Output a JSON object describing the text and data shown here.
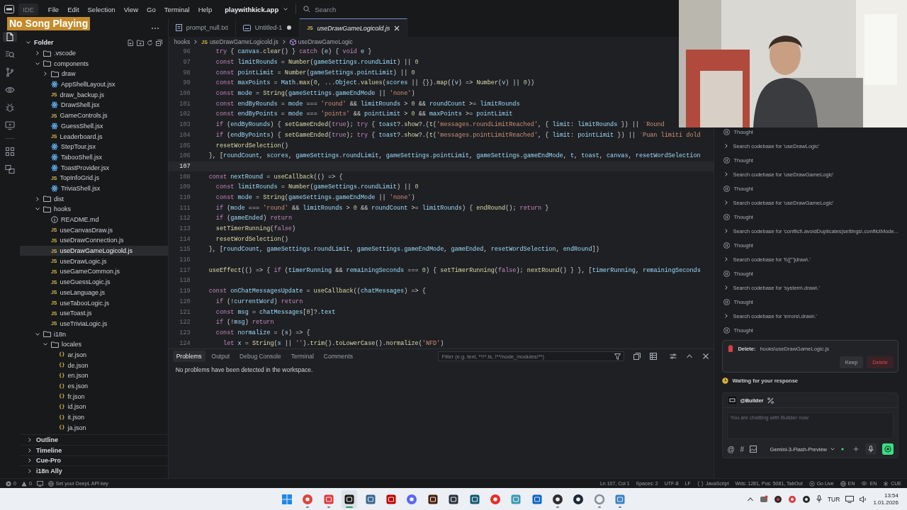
{
  "overlay": {
    "text": "No Song Playing"
  },
  "menubar": {
    "app_label": "IDE",
    "menus": [
      "File",
      "Edit",
      "Selection",
      "View",
      "Go",
      "Terminal",
      "Help"
    ],
    "workspace": "playwithkick.app",
    "search_placeholder": "Search"
  },
  "activity_bar": [
    {
      "kind": "files",
      "selected": true
    },
    {
      "kind": "search",
      "selected": false
    },
    {
      "kind": "branch",
      "selected": false
    },
    {
      "kind": "eye",
      "selected": false
    },
    {
      "kind": "bug",
      "selected": false
    },
    {
      "kind": "monitor",
      "selected": false
    },
    {
      "kind": "grid",
      "selected": false
    },
    {
      "kind": "translate",
      "selected": false
    }
  ],
  "explorer": {
    "root": {
      "label": "Folder",
      "expanded": true,
      "children": [
        {
          "label": ".vscode",
          "kind": "folder",
          "expanded": false,
          "selected": false
        },
        {
          "label": "components",
          "kind": "folder",
          "expanded": true,
          "selected": false,
          "children": [
            {
              "label": "draw",
              "kind": "folder",
              "expanded": false,
              "selected": false
            },
            {
              "label": "AppShellLayout.jsx",
              "kind": "jsx",
              "selected": false
            },
            {
              "label": "draw_backup.js",
              "kind": "js",
              "icon_text": "JS",
              "selected": false
            },
            {
              "label": "DrawShell.jsx",
              "kind": "jsx",
              "selected": false
            },
            {
              "label": "GameControls.js",
              "kind": "js",
              "icon_text": "JS",
              "selected": false
            },
            {
              "label": "GuessShell.jsx",
              "kind": "jsx",
              "selected": false
            },
            {
              "label": "Leaderboard.js",
              "kind": "js",
              "icon_text": "JS",
              "selected": false
            },
            {
              "label": "StepTour.jsx",
              "kind": "jsx",
              "selected": false
            },
            {
              "label": "TabooShell.jsx",
              "kind": "jsx",
              "selected": false
            },
            {
              "label": "ToastProvider.jsx",
              "kind": "jsx",
              "selected": false
            },
            {
              "label": "TopInfoGrid.js",
              "kind": "js",
              "icon_text": "JS",
              "selected": false
            },
            {
              "label": "TriviaShell.jsx",
              "kind": "jsx",
              "selected": false
            }
          ]
        },
        {
          "label": "dist",
          "kind": "folder",
          "expanded": false,
          "selected": false
        },
        {
          "label": "hooks",
          "kind": "folder",
          "expanded": true,
          "selected": false,
          "children": [
            {
              "label": "README.md",
              "kind": "md",
              "selected": false
            },
            {
              "label": "useCanvasDraw.js",
              "kind": "js",
              "icon_text": "JS",
              "selected": false
            },
            {
              "label": "useDrawConnection.js",
              "kind": "js",
              "icon_text": "JS",
              "selected": false
            },
            {
              "label": "useDrawGameLogicold.js",
              "kind": "js",
              "icon_text": "JS",
              "selected": true
            },
            {
              "label": "useDrawLogic.js",
              "kind": "js",
              "icon_text": "JS",
              "selected": false
            },
            {
              "label": "useGameCommon.js",
              "kind": "js",
              "icon_text": "JS",
              "selected": false
            },
            {
              "label": "useGuessLogic.js",
              "kind": "js",
              "icon_text": "JS",
              "selected": false
            },
            {
              "label": "useLanguage.js",
              "kind": "js",
              "icon_text": "JS",
              "selected": false
            },
            {
              "label": "useTabooLogic.js",
              "kind": "js",
              "icon_text": "JS",
              "selected": false
            },
            {
              "label": "useToast.js",
              "kind": "js",
              "icon_text": "JS",
              "selected": false
            },
            {
              "label": "useTriviaLogic.js",
              "kind": "js",
              "icon_text": "JS",
              "selected": false
            }
          ]
        },
        {
          "label": "i18n",
          "kind": "folder",
          "expanded": true,
          "selected": false,
          "children": [
            {
              "label": "locales",
              "kind": "folder",
              "expanded": true,
              "selected": false,
              "children": [
                {
                  "label": "ar.json",
                  "kind": "json",
                  "icon_text": "{}",
                  "selected": false
                },
                {
                  "label": "de.json",
                  "kind": "json",
                  "icon_text": "{}",
                  "selected": false
                },
                {
                  "label": "en.json",
                  "kind": "json",
                  "icon_text": "{}",
                  "selected": false
                },
                {
                  "label": "es.json",
                  "kind": "json",
                  "icon_text": "{}",
                  "selected": false
                },
                {
                  "label": "fr.json",
                  "kind": "json",
                  "icon_text": "{}",
                  "selected": false
                },
                {
                  "label": "id.json",
                  "kind": "json",
                  "icon_text": "{}",
                  "selected": false
                },
                {
                  "label": "it.json",
                  "kind": "json",
                  "icon_text": "{}",
                  "selected": false
                },
                {
                  "label": "ja.json",
                  "kind": "json",
                  "icon_text": "{}",
                  "selected": false
                }
              ]
            }
          ]
        }
      ]
    }
  },
  "sidebar_sections": [
    {
      "label": "Outline",
      "expanded": false
    },
    {
      "label": "Timeline",
      "expanded": false
    },
    {
      "label": "Cue-Pro",
      "expanded": false
    },
    {
      "label": "i18n Ally",
      "expanded": false
    }
  ],
  "editor": {
    "tabs": [
      {
        "label": "prompt_null.txt",
        "kind": "text",
        "selected": false,
        "modified": false
      },
      {
        "label": "Untitled-1",
        "kind": "untitled",
        "selected": false,
        "modified": true
      },
      {
        "label": "useDrawGameLogicold.js",
        "kind": "js",
        "icon_text": "JS",
        "selected": true,
        "modified": false
      }
    ],
    "breadcrumb": [
      {
        "text": "hooks"
      },
      {
        "text": "useDrawGameLogicold.js",
        "icon_text": "JS"
      },
      {
        "text": "useDrawGameLogic",
        "kind": "symbol"
      }
    ],
    "lines": [
      {
        "number": "96",
        "current": false,
        "code": "  try { canvas.clear() } catch (e) { void e }"
      },
      {
        "number": "97",
        "current": false,
        "code": "  const limitRounds = Number(gameSettings.roundLimit) || 0"
      },
      {
        "number": "98",
        "current": false,
        "code": "  const pointLimit = Number(gameSettings.pointLimit) || 0"
      },
      {
        "number": "99",
        "current": false,
        "code": "  const maxPoints = Math.max(0, ...Object.values(scores || {}).map((v) => Number(v) || 0))"
      },
      {
        "number": "100",
        "current": false,
        "code": "  const mode = String(gameSettings.gameEndMode || 'none')"
      },
      {
        "number": "101",
        "current": false,
        "code": "  const endByRounds = mode === 'round' && limitRounds > 0 && roundCount >= limitRounds"
      },
      {
        "number": "102",
        "current": false,
        "code": "  const endByPoints = mode === 'points' && pointLimit > 0 && maxPoints >= pointLimit"
      },
      {
        "number": "103",
        "current": false,
        "code": "  if (endByRounds) { setGameEnded(true); try { toast?.show?.(t('messages.roundLimitReached', { limit: limitRounds }) || `Round"
      },
      {
        "number": "104",
        "current": false,
        "code": "  if (endByPoints) { setGameEnded(true); try { toast?.show?.(t('messages.pointLimitReached', { limit: pointLimit }) || `Puan limiti dold"
      },
      {
        "number": "105",
        "current": false,
        "code": "  resetWordSelection()"
      },
      {
        "number": "106",
        "current": false,
        "code": "}, [roundCount, scores, gameSettings.roundLimit, gameSettings.pointLimit, gameSettings.gameEndMode, t, toast, canvas, resetWordSelection"
      },
      {
        "number": "107",
        "current": true
      },
      {
        "number": "108",
        "current": false,
        "code": "const nextRound = useCallback(() => {"
      },
      {
        "number": "109",
        "current": false,
        "code": "  const limitRounds = Number(gameSettings.roundLimit) || 0"
      },
      {
        "number": "110",
        "current": false,
        "code": "  const mode = String(gameSettings.gameEndMode || 'none')"
      },
      {
        "number": "111",
        "current": false,
        "code": "  if (mode === 'round' && limitRounds > 0 && roundCount >= limitRounds) { endRound(); return }"
      },
      {
        "number": "112",
        "current": false,
        "code": "  if (gameEnded) return"
      },
      {
        "number": "113",
        "current": false,
        "code": "  setTimerRunning(false)"
      },
      {
        "number": "114",
        "current": false,
        "code": "  resetWordSelection()"
      },
      {
        "number": "115",
        "current": false,
        "code": "}, [roundCount, gameSettings.roundLimit, gameSettings.gameEndMode, gameEnded, resetWordSelection, endRound])"
      },
      {
        "number": "116",
        "current": false
      },
      {
        "number": "117",
        "current": false,
        "code": "useEffect(() => { if (timerRunning && remainingSeconds === 0) { setTimerRunning(false); nextRound() } }, [timerRunning, remainingSeconds"
      },
      {
        "number": "118",
        "current": false
      },
      {
        "number": "119",
        "current": false,
        "code": "const onChatMessagesUpdate = useCallback((chatMessages) => {"
      },
      {
        "number": "120",
        "current": false,
        "code": "  if (!currentWord) return"
      },
      {
        "number": "121",
        "current": false,
        "code": "  const msg = chatMessages[0]?.text"
      },
      {
        "number": "122",
        "current": false,
        "code": "  if (!msg) return"
      },
      {
        "number": "123",
        "current": false,
        "code": "  const normalize = (s) => {"
      },
      {
        "number": "124",
        "current": false,
        "code": "    let x = String(s || '').trim().toLowerCase().normalize('NFD')"
      }
    ]
  },
  "panel": {
    "tabs": [
      {
        "label": "Problems",
        "selected": true
      },
      {
        "label": "Output",
        "selected": false
      },
      {
        "label": "Debug Console",
        "selected": false
      },
      {
        "label": "Terminal",
        "selected": false
      },
      {
        "label": "Comments",
        "selected": false
      }
    ],
    "filter_placeholder": "Filter (e.g. text, **/*.ts, !**/node_modules/**)",
    "message": "No problems have been detected in the workspace."
  },
  "chat": {
    "items": [
      {
        "kind": "thought",
        "text": "Thought"
      },
      {
        "kind": "search",
        "text": "Search codebase for 'useDrawLogic'"
      },
      {
        "kind": "thought",
        "text": "Thought"
      },
      {
        "kind": "search",
        "text": "Search codebase for 'useDrawGameLogic'"
      },
      {
        "kind": "thought",
        "text": "Thought"
      },
      {
        "kind": "search",
        "text": "Search codebase for 'useDrawGameLogic'"
      },
      {
        "kind": "thought",
        "text": "Thought"
      },
      {
        "kind": "search",
        "text": "Search codebase for 'conflict\\.avoidDuplicates|settings\\.conflictMode..."
      },
      {
        "kind": "thought",
        "text": "Thought"
      },
      {
        "kind": "search",
        "text": "Search codebase for 't\\(['\"]draw\\.'"
      },
      {
        "kind": "thought",
        "text": "Thought"
      },
      {
        "kind": "search",
        "text": "Search codebase for 'system\\.draw\\.'"
      },
      {
        "kind": "thought",
        "text": "Thought"
      },
      {
        "kind": "search",
        "text": "Search codebase for 'errors\\.draw\\.'"
      },
      {
        "kind": "thought",
        "text": "Thought"
      }
    ],
    "confirm": {
      "label": "Delete:",
      "path": "hooks\\useDrawGameLogic.js",
      "buttons": [
        {
          "label": "Keep",
          "kind": "secondary"
        },
        {
          "label": "Delete",
          "kind": "danger"
        }
      ]
    },
    "status": "Waiting for your response",
    "composer": {
      "agent": "@Builder",
      "placeholder": "You are chatting with Builder now",
      "tools": [
        "@",
        "#"
      ],
      "model": "Gemini-3-Flash-Preview"
    }
  },
  "status_bar": {
    "errors": "0",
    "warnings": "0",
    "deepl": "Set your DeepL API key",
    "right": [
      {
        "text": "Ln 107, Col 1"
      },
      {
        "text": "Spaces: 2"
      },
      {
        "text": "UTF-8"
      },
      {
        "text": "LF"
      },
      {
        "text": "JavaScript",
        "kind": "language"
      },
      {
        "text": "Wds: 1281, Pos: 5081, TabOut"
      },
      {
        "text": "Go Live",
        "kind": "live"
      },
      {
        "text": "EN",
        "kind": "translate"
      },
      {
        "text": "EN",
        "kind": "spell"
      },
      {
        "text": "CUE",
        "kind": "cue"
      }
    ]
  },
  "taskbar": {
    "apps": [
      {
        "kind": "start",
        "running": false,
        "selected": false
      },
      {
        "kind": "ball",
        "running": true,
        "selected": false
      },
      {
        "kind": "redv",
        "running": true,
        "selected": false
      },
      {
        "kind": "terminal",
        "running": true,
        "selected": true
      },
      {
        "kind": "elephant",
        "running": false,
        "selected": false
      },
      {
        "kind": "redf",
        "running": false,
        "selected": false
      },
      {
        "kind": "chat",
        "running": false,
        "selected": false
      },
      {
        "kind": "brownsq",
        "running": false,
        "selected": false
      },
      {
        "kind": "darksq",
        "running": false,
        "selected": false
      },
      {
        "kind": "tealsq",
        "running": false,
        "selected": false
      },
      {
        "kind": "play",
        "running": false,
        "selected": false
      },
      {
        "kind": "stack",
        "running": false,
        "selected": false
      },
      {
        "kind": "mail",
        "running": false,
        "selected": false
      },
      {
        "kind": "disc",
        "running": true,
        "selected": false
      },
      {
        "kind": "steam",
        "running": false,
        "selected": false
      },
      {
        "kind": "ring",
        "running": true,
        "selected": false
      },
      {
        "kind": "note",
        "running": true,
        "selected": false
      }
    ],
    "language": "TUR",
    "time": "13:54",
    "date": "1.01.2026"
  }
}
